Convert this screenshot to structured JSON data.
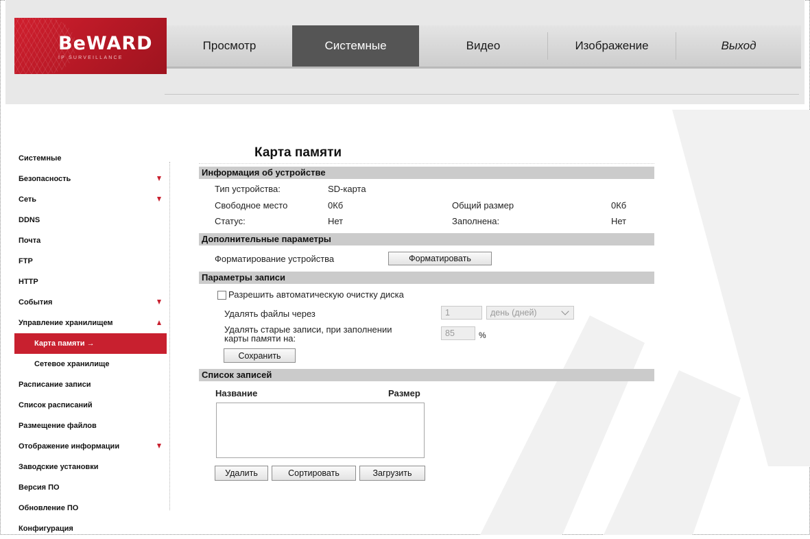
{
  "logo": {
    "brand": "BeWARD",
    "tagline": "IP SURVEILLANCE"
  },
  "nav": {
    "tabs": [
      {
        "label": "Просмотр",
        "active": false
      },
      {
        "label": "Системные",
        "active": true
      },
      {
        "label": "Видео",
        "active": false
      },
      {
        "label": "Изображение",
        "active": false
      },
      {
        "label": "Выход",
        "active": false
      }
    ]
  },
  "sidebar": {
    "items": [
      {
        "label": "Системные"
      },
      {
        "label": "Безопасность",
        "arrow": "down"
      },
      {
        "label": "Сеть",
        "arrow": "down"
      },
      {
        "label": "DDNS"
      },
      {
        "label": "Почта"
      },
      {
        "label": "FTP"
      },
      {
        "label": "HTTP"
      },
      {
        "label": "События",
        "arrow": "down"
      },
      {
        "label": "Управление хранилищем",
        "arrow": "up"
      },
      {
        "label": "Карта памяти",
        "sub": true,
        "active": true,
        "suffix": "→"
      },
      {
        "label": "Сетевое хранилище",
        "sub": true
      },
      {
        "label": "Расписание записи"
      },
      {
        "label": "Список расписаний"
      },
      {
        "label": "Размещение файлов"
      },
      {
        "label": "Отображение информации",
        "arrow": "down"
      },
      {
        "label": "Заводские установки"
      },
      {
        "label": "Версия ПО"
      },
      {
        "label": "Обновление ПО"
      },
      {
        "label": "Конфигурация"
      }
    ]
  },
  "main": {
    "title": "Карта памяти",
    "device_info": {
      "header": "Информация об устройстве",
      "type_label": "Тип устройства:",
      "type_value": "SD-карта",
      "free_label": "Свободное место",
      "free_value": "0Кб",
      "total_label": "Общий размер",
      "total_value": "0Кб",
      "status_label": "Статус:",
      "status_value": "Нет",
      "full_label": "Заполнена:",
      "full_value": "Нет"
    },
    "extra": {
      "header": "Дополнительные параметры",
      "format_label": "Форматирование устройства",
      "format_button": "Форматировать"
    },
    "record": {
      "header": "Параметры записи",
      "auto_clean_label": "Разрешить автоматическую очистку диска",
      "auto_clean_checked": false,
      "delete_after_label": "Удалять файлы через",
      "delete_after_value": "1",
      "delete_after_unit": "день (дней)",
      "delete_old_label_1": "Удалять старые записи, при заполнении",
      "delete_old_label_2": "карты памяти на:",
      "delete_old_value": "85",
      "delete_old_unit": "%",
      "save_button": "Сохранить"
    },
    "records_list": {
      "header": "Список записей",
      "col_name": "Название",
      "col_size": "Размер",
      "items": [],
      "delete_button": "Удалить",
      "sort_button": "Сортировать",
      "load_button": "Загрузить"
    }
  },
  "colors": {
    "accent": "#c8202f",
    "active_tab": "#555555",
    "section_header": "#cbcbcb"
  }
}
